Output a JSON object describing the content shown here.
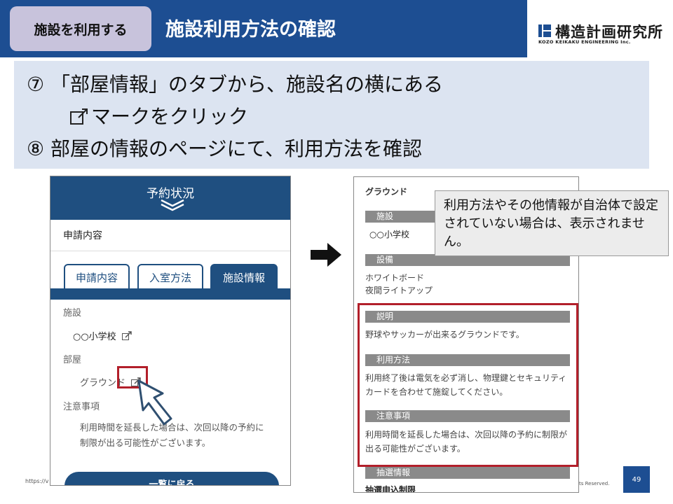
{
  "header": {
    "section_label": "施設を利用する",
    "title": "施設利用方法の確認",
    "logo_jp": "構造計画研究所",
    "logo_en": "KOZO KEIKAKU ENGINEERING Inc."
  },
  "instructions": {
    "line1": "⑦ 「部屋情報」のタブから、施設名の横にある",
    "line2": "マークをクリック",
    "line3": "⑧ 部屋の情報のページにて、利用方法を確認"
  },
  "left_screen": {
    "top_title": "予約状況",
    "request_heading": "申請内容",
    "tabs": [
      "申請内容",
      "入室方法",
      "施設情報"
    ],
    "active_tab": 2,
    "facility_label": "施設",
    "facility_value": "○○小学校",
    "room_label": "部屋",
    "room_value": "グラウンド",
    "notes_label": "注意事項",
    "notes_text": "利用時間を延長した場合は、次回以降の予約に制限が出る可能性がございます。",
    "back_button": "一覧に戻る",
    "url_partial": "https://v"
  },
  "right_screen": {
    "heading": "グラウンド",
    "facility_bar": "施設",
    "facility_value": "○○小学校",
    "equipment_bar": "設備",
    "equipment_items": [
      "ホワイトボード",
      "夜間ライトアップ"
    ],
    "description_bar": "説明",
    "description_text": "野球やサッカーが出来るグラウンドです。",
    "usage_bar": "利用方法",
    "usage_text": "利用終了後は電気を必ず消し、物理鍵とセキュリティカードを合わせて施錠してください。",
    "notes_bar": "注意事項",
    "notes_text": "利用時間を延長した場合は、次回以降の予約に制限が出る可能性がございます。",
    "lottery_bar": "抽選情報",
    "lottery_sub": "抽選申込制限"
  },
  "callout": {
    "text": "利用方法やその他情報が自治体で設定されていない場合は、表示されません。"
  },
  "footer": {
    "copyright_partial": "ts Reserved.",
    "page_number": "49"
  },
  "colors": {
    "header_blue": "#1d4e92",
    "app_blue": "#1f4f80",
    "highlight_red": "#b21f2a",
    "instruction_bg": "#dce4f1",
    "pill_bg": "#c8c3dc"
  }
}
